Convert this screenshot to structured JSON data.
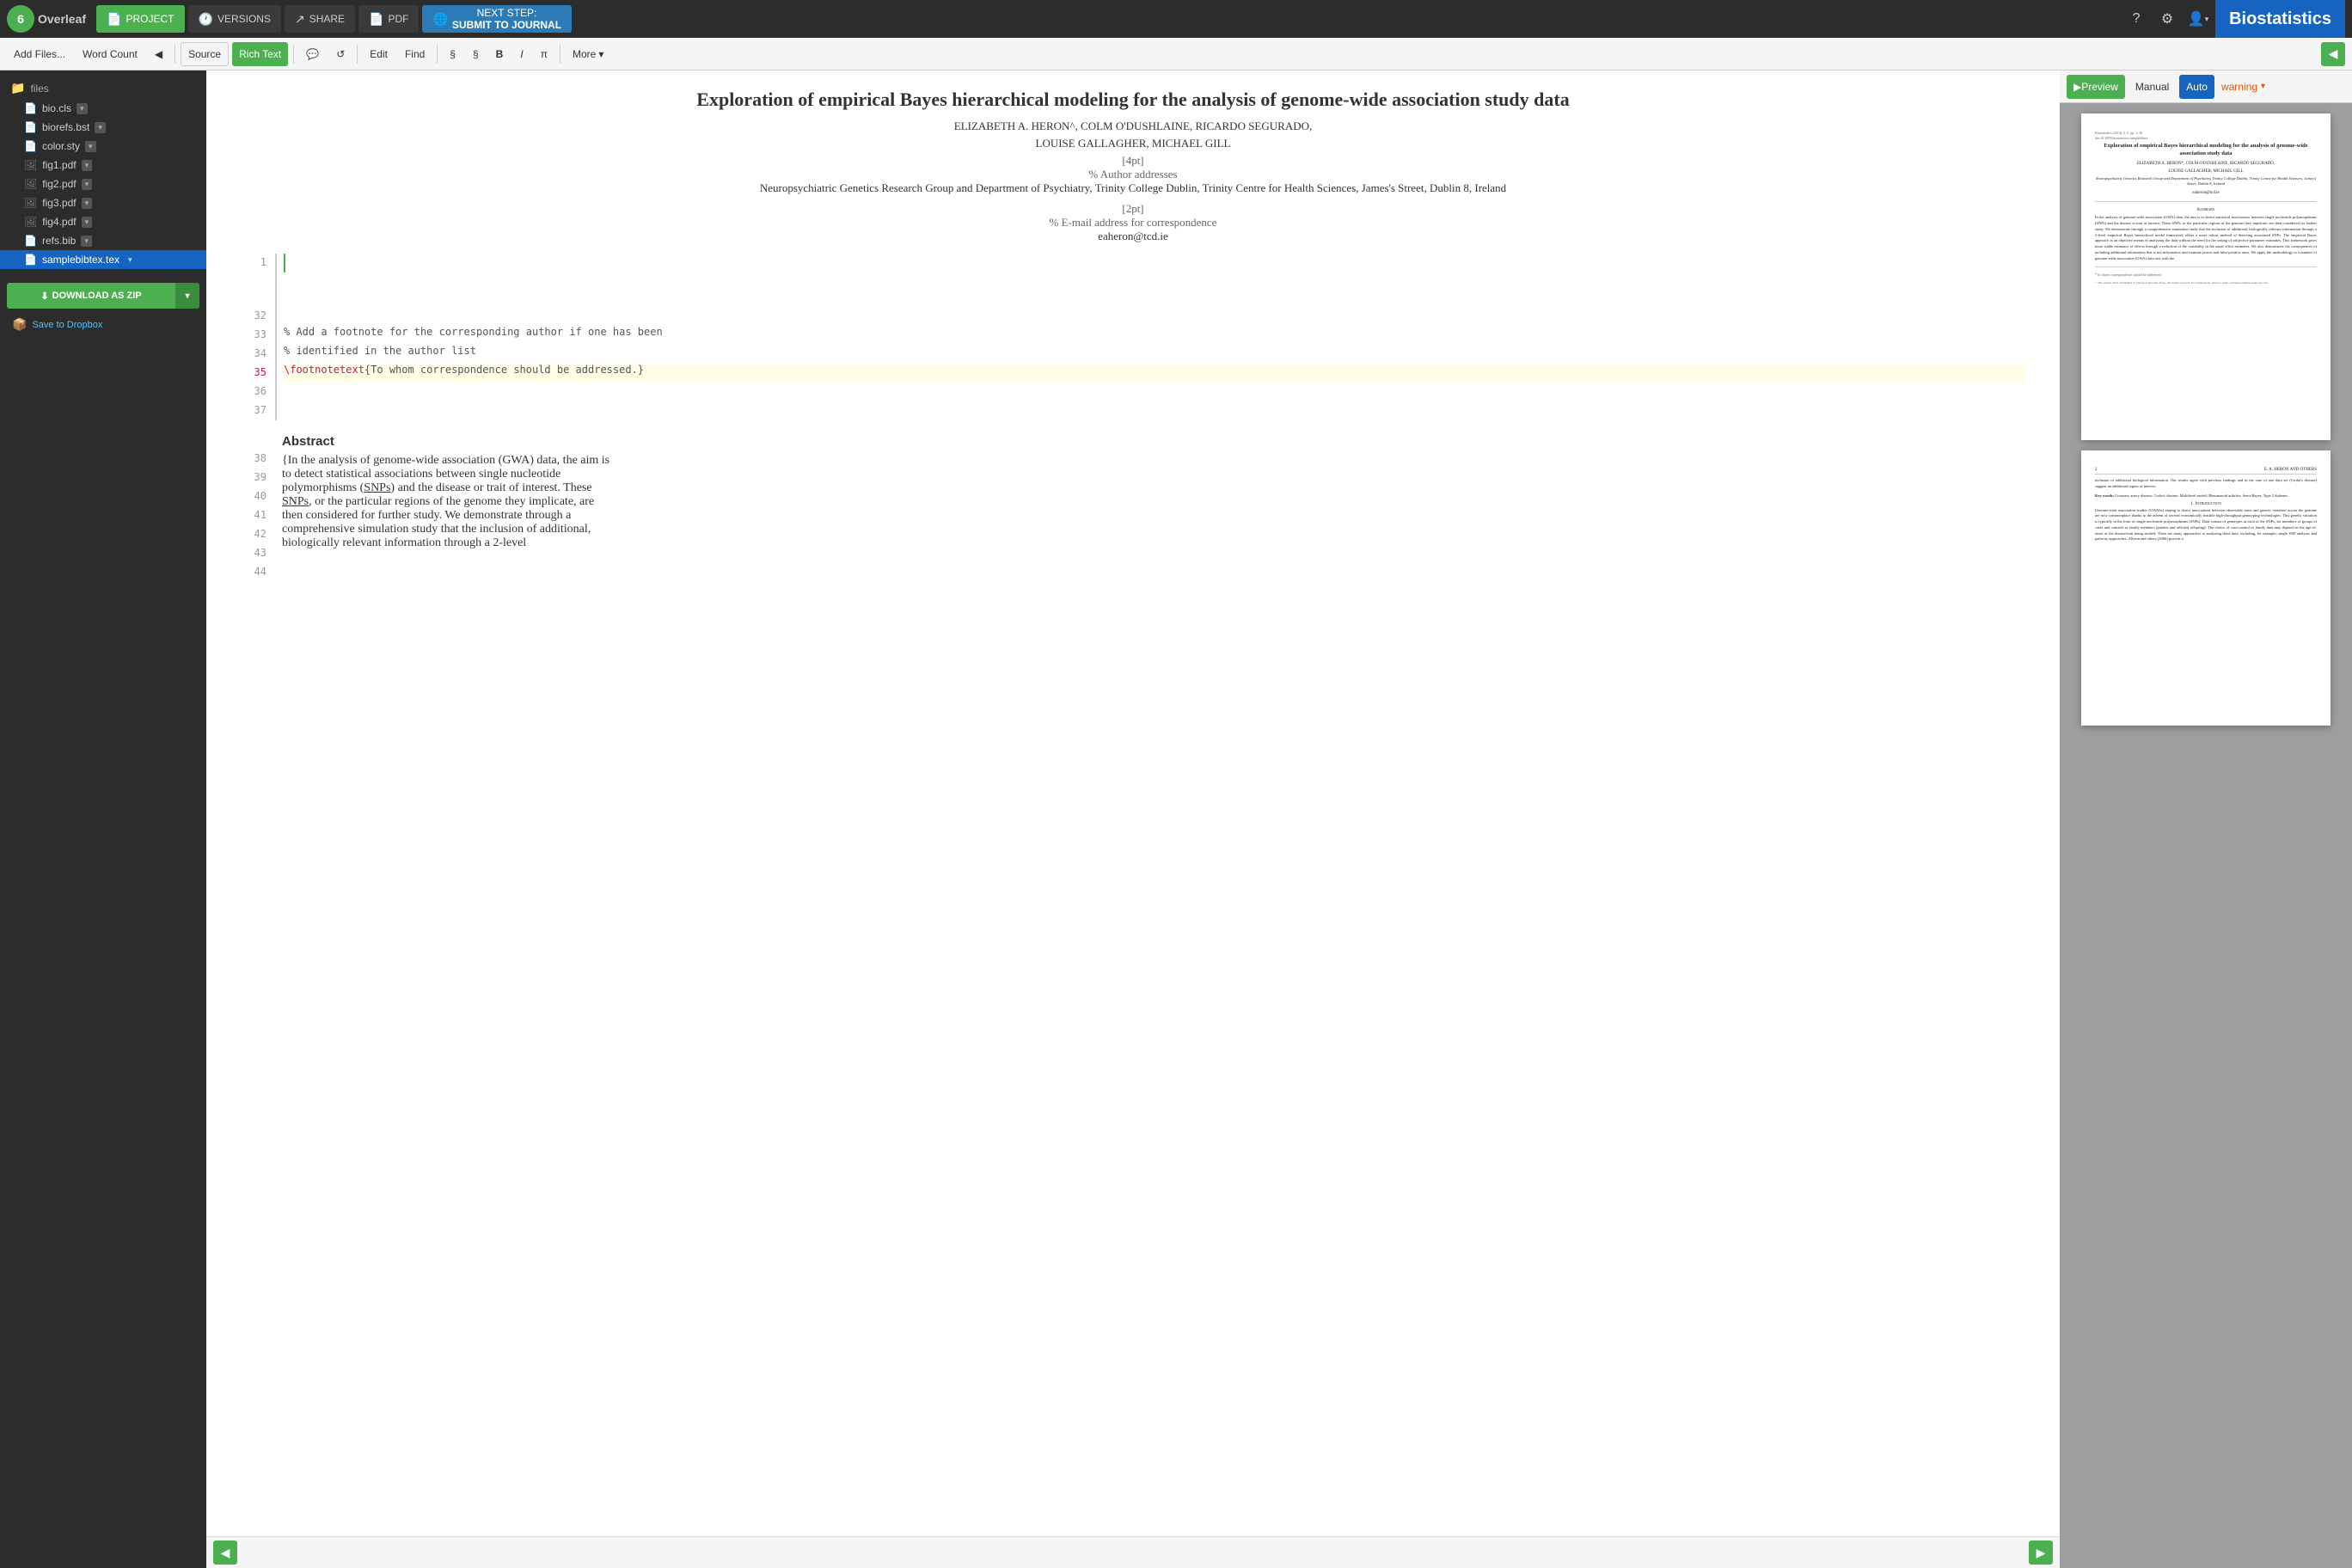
{
  "app": {
    "logo_text": "6",
    "logo_name": "Overleaf"
  },
  "top_navbar": {
    "project_label": "PROJECT",
    "versions_label": "VERSIONS",
    "share_label": "SHARE",
    "pdf_label": "PDF",
    "next_step_label": "NEXT STEP:",
    "submit_label": "SUBMIT TO JOURNAL",
    "help_icon": "?",
    "settings_icon": "⚙",
    "user_icon": "👤",
    "biostatistics_label": "Biostatistics"
  },
  "second_toolbar": {
    "add_files_label": "Add Files...",
    "word_count_label": "Word Count",
    "collapse_icon": "◀",
    "source_label": "Source",
    "rich_text_label": "Rich Text",
    "comment_icon": "+💬",
    "history_icon": "↺",
    "edit_label": "Edit",
    "find_label": "Find",
    "section_icon": "§",
    "bold_icon": "B",
    "italic_icon": "I",
    "math_icon": "π",
    "more_label": "More",
    "more_chevron": "▾",
    "left_arrow": "◀",
    "right_arrow": "▶"
  },
  "sidebar": {
    "files_label": "files",
    "items": [
      {
        "name": "bio.cls",
        "has_chevron": true
      },
      {
        "name": "biorefs.bst",
        "has_chevron": true
      },
      {
        "name": "color.sty",
        "has_chevron": true
      },
      {
        "name": "fig1.pdf",
        "has_chevron": true
      },
      {
        "name": "fig2.pdf",
        "has_chevron": true
      },
      {
        "name": "fig3.pdf",
        "has_chevron": true
      },
      {
        "name": "fig4.pdf",
        "has_chevron": true
      },
      {
        "name": "refs.bib",
        "has_chevron": true
      },
      {
        "name": "samplebibtex.tex",
        "has_chevron": true,
        "active": true
      }
    ],
    "download_zip_label": "DOWNLOAD AS ZIP",
    "dropbox_label": "Save to Dropbox"
  },
  "editor": {
    "doc_title": "Exploration of empirical Bayes hierarchical modeling for the analysis of genome-wide association study data",
    "authors_line1": "ELIZABETH A. HERON^, COLM O'DUSHLAINE, RICARDO SEGURADO,",
    "authors_line2": "LOUISE GALLAGHER, MICHAEL GILL",
    "comment1": "% Author addresses",
    "institution": "Neuropsychiatric Genetics Research Group and Department of Psychiatry, Trinity College Dublin, Trinity Centre for Health Sciences, James's Street, Dublin 8, Ireland",
    "comment2": "% E-mail address for correspondence",
    "email": "eaheron@tcd.ie",
    "code_lines": [
      {
        "num": 1,
        "text": ""
      },
      {
        "num": 32,
        "text": ""
      },
      {
        "num": 33,
        "text": "% Add a footnote for the corresponding author if one has been"
      },
      {
        "num": 34,
        "text": "% identified in the author list"
      },
      {
        "num": 35,
        "text": "\\footnotetext{To whom correspondence should be addressed.}",
        "highlight": true
      },
      {
        "num": 36,
        "text": ""
      },
      {
        "num": 37,
        "text": ""
      }
    ],
    "abstract_title": "Abstract",
    "abstract_lines": [
      {
        "num": 38,
        "text": "{In the analysis of genome-wide association (GWA) data, the aim is"
      },
      {
        "num": 39,
        "text": "to detect statistical associations between single nucleotide"
      },
      {
        "num": 40,
        "text": "polymorphisms (SNPs) and the disease or trait of interest. These"
      },
      {
        "num": 41,
        "text": "SNPs, or the particular regions of the genome they implicate, are"
      },
      {
        "num": 42,
        "text": "then considered for further study. We demonstrate through a"
      },
      {
        "num": 43,
        "text": "comprehensive simulation study that the inclusion of additional,"
      },
      {
        "num": 44,
        "text": "biologically relevant information through a 2-level"
      }
    ]
  },
  "preview": {
    "preview_label": "Preview",
    "manual_label": "Manual",
    "auto_label": "Auto",
    "warning_label": "warning",
    "page1": {
      "doi": "Biostatistics (2014), 0, 0, pp. 1–30",
      "doi2": "doi:10.1093/biostatistics/samplebibtex",
      "title": "Exploration of empirical Bayes hierarchical modeling for the analysis of genome-wide association study data",
      "authors": "ELIZABETH A. HERON*, COLM O'DUSHLAINE, RICARDO SEGURADO,",
      "authors2": "LOUISE GALLAGHER, MICHAEL GILL",
      "institution": "Neuropsychiatric Genetics Research Group and Department of Psychiatry, Trinity College Dublin, Trinity Centre for Health Sciences, James's Street, Dublin 8, Ireland",
      "email": "eaheron@tcd.ie",
      "summary_title": "Summary",
      "summary_text": "In the analysis of genome-wide association (GWA) data, the aim is to detect statistical associations between single nucleotide polymorphisms (SNPs) and the disease or trait of interest. These SNPs, or the particular regions of the genome they implicate, are then considered for further study. We demonstrate through a comprehensive simulation study that the inclusion of additional, biologically relevant information through a 2-level empirical Bayes hierarchical model framework offers a more robust method of detecting associated SNPs. The empirical Bayes approach is an objective means of analyzing the data without the need for the setting of subjective parameter estimates. This framework gives more stable estimates of effects through a reduction of the variability in the usual effect estimates. We also demonstrate the consequences of including additional information that is not informative and examine power and false-positive rates. We apply the methodology to a number of genome-wide association (GWA) data sets with the",
      "footnote": "*To whom correspondence should be addressed.",
      "copyright": "© The Author 2014. Published by Oxford University Press. All rights reserved. For permissions, please e-mail: journals.permissions@oup.com"
    },
    "page2": {
      "page_num": "2",
      "authors": "E. A. HERON AND OTHERS",
      "body_text": "inclusion of additional biological information. Our results agree with previous findings and in the case of one data set (Crohn's disease) suggest an additional region of interest.",
      "keywords_label": "Key words:",
      "keywords": "Coronary artery disease; Crohn's disease; Multilevel model; Rheumatoid arthritis; Semi-Bayes; Type 2 diabetes.",
      "section_title": "1. Introduction",
      "intro_text": "Genome-wide association studies (GWASs) aiming to detect associations between observable traits and genetic variation across the genome are now commonplace thanks to the advent of several economically feasible high-throughput genotyping technologies. This genetic variation is typically in the form of single nucleotide polymorphisms (SNPs). Data consist of genotypes at each of the SNPs, for members of groups of cases and controls or family members (parents and affected offspring). The choice of case-control or family data may depend on the age-of-onset of the disease/trait being studied. There are many approaches to analyzing these data, including, for example; single SNP analyses and pathway approaches. Allison and others (2006) provide a"
    }
  }
}
